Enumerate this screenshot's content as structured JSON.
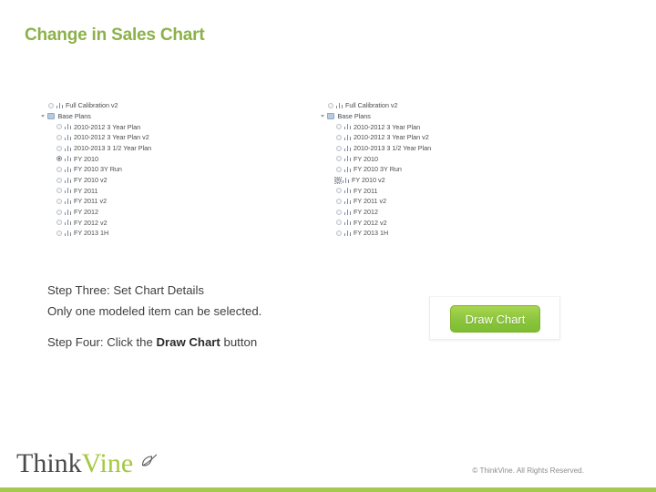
{
  "slide": {
    "title": "Change in Sales Chart"
  },
  "trees": [
    {
      "name": "left-tree",
      "rows": [
        {
          "type": "item",
          "label": "Full Calibration v2",
          "indent": 1,
          "selected": false,
          "focused": false
        },
        {
          "type": "folder",
          "label": "Base Plans",
          "indent": 0,
          "expanded": true
        },
        {
          "type": "item",
          "label": "2010-2012 3 Year Plan",
          "indent": 2,
          "selected": false,
          "focused": false
        },
        {
          "type": "item",
          "label": "2010-2012 3 Year Plan v2",
          "indent": 2,
          "selected": false,
          "focused": false
        },
        {
          "type": "item",
          "label": "2010-2013 3 1/2 Year Plan",
          "indent": 2,
          "selected": false,
          "focused": false
        },
        {
          "type": "item",
          "label": "FY 2010",
          "indent": 2,
          "selected": true,
          "focused": false
        },
        {
          "type": "item",
          "label": "FY 2010 3Y Run",
          "indent": 2,
          "selected": false,
          "focused": false
        },
        {
          "type": "item",
          "label": "FY 2010 v2",
          "indent": 2,
          "selected": false,
          "focused": false
        },
        {
          "type": "item",
          "label": "FY 2011",
          "indent": 2,
          "selected": false,
          "focused": false
        },
        {
          "type": "item",
          "label": "FY 2011 v2",
          "indent": 2,
          "selected": false,
          "focused": false
        },
        {
          "type": "item",
          "label": "FY 2012",
          "indent": 2,
          "selected": false,
          "focused": false
        },
        {
          "type": "item",
          "label": "FY 2012 v2",
          "indent": 2,
          "selected": false,
          "focused": false
        },
        {
          "type": "item",
          "label": "FY 2013 1H",
          "indent": 2,
          "selected": false,
          "focused": false
        }
      ]
    },
    {
      "name": "right-tree",
      "rows": [
        {
          "type": "item",
          "label": "Full Calibration v2",
          "indent": 1,
          "selected": false,
          "focused": false
        },
        {
          "type": "folder",
          "label": "Base Plans",
          "indent": 0,
          "expanded": true
        },
        {
          "type": "item",
          "label": "2010-2012 3 Year Plan",
          "indent": 2,
          "selected": false,
          "focused": false
        },
        {
          "type": "item",
          "label": "2010-2012 3 Year Plan v2",
          "indent": 2,
          "selected": false,
          "focused": false
        },
        {
          "type": "item",
          "label": "2010-2013 3 1/2 Year Plan",
          "indent": 2,
          "selected": false,
          "focused": false
        },
        {
          "type": "item",
          "label": "FY 2010",
          "indent": 2,
          "selected": false,
          "focused": false
        },
        {
          "type": "item",
          "label": "FY 2010 3Y Run",
          "indent": 2,
          "selected": false,
          "focused": false
        },
        {
          "type": "item",
          "label": "FY 2010 v2",
          "indent": 2,
          "selected": true,
          "focused": true
        },
        {
          "type": "item",
          "label": "FY 2011",
          "indent": 2,
          "selected": false,
          "focused": false
        },
        {
          "type": "item",
          "label": "FY 2011 v2",
          "indent": 2,
          "selected": false,
          "focused": false
        },
        {
          "type": "item",
          "label": "FY 2012",
          "indent": 2,
          "selected": false,
          "focused": false
        },
        {
          "type": "item",
          "label": "FY 2012 v2",
          "indent": 2,
          "selected": false,
          "focused": false
        },
        {
          "type": "item",
          "label": "FY 2013 1H",
          "indent": 2,
          "selected": false,
          "focused": false
        }
      ]
    }
  ],
  "steps": {
    "step_three_heading": "Step Three: Set Chart Details",
    "step_three_note": "Only one modeled item can be selected.",
    "step_four_prefix": "Step Four: Click the ",
    "step_four_emphasis": "Draw Chart",
    "step_four_suffix": " button"
  },
  "button_panel": {
    "draw_chart_label": "Draw Chart"
  },
  "footer": {
    "logo_part_one": "Think",
    "logo_part_two": "Vine",
    "copyright": "© ThinkVine.  All Rights Reserved."
  },
  "colors": {
    "title_green": "#8cb14a",
    "button_green": "#8dc63f",
    "bar_green": "#a6c84f",
    "logo_green": "#a4c83f",
    "body_text": "#3f3f3f"
  }
}
